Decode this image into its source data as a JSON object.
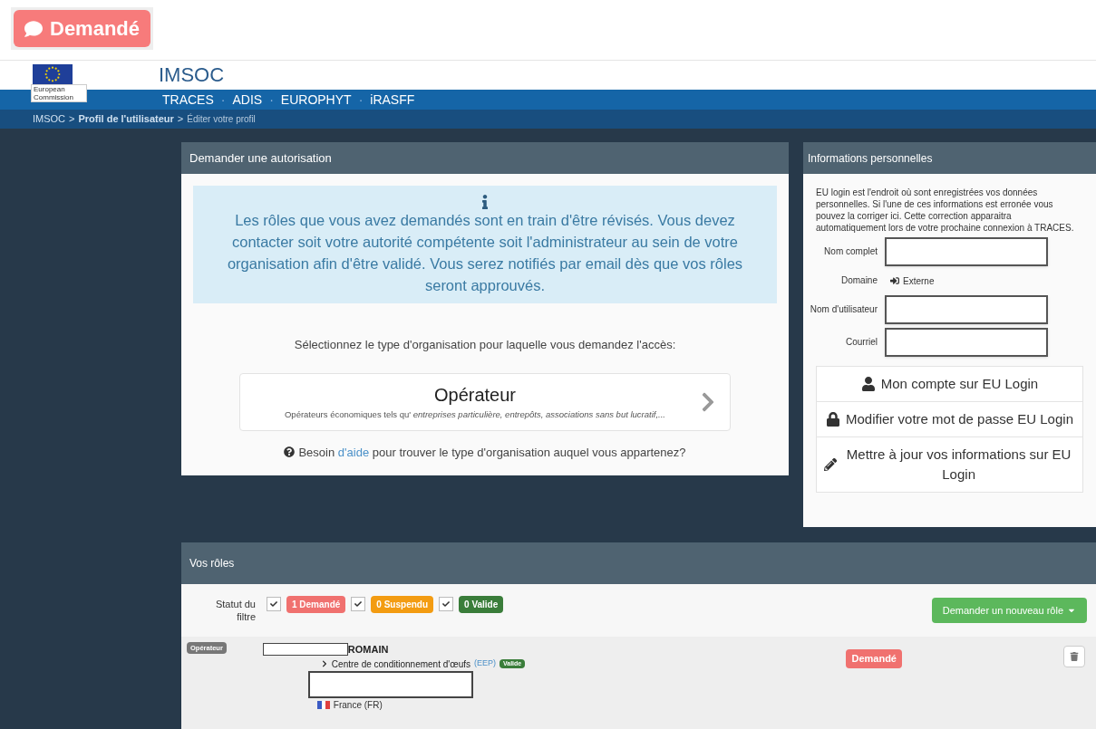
{
  "top_badge": {
    "label": "Demandé"
  },
  "header": {
    "logo_caption": "European Commission",
    "title": "IMSOC",
    "nav": [
      "TRACES",
      "ADIS",
      "EUROPHYT",
      "iRASFF"
    ],
    "nav_separator": "·",
    "breadcrumb_separator": ">",
    "breadcrumb": [
      "IMSOC",
      "Profil de l'utilisateur",
      "Éditer votre profil"
    ]
  },
  "request_panel": {
    "title": "Demander une autorisation",
    "info": "Les rôles que vous avez demandés sont en train d'être révisés. Vous devez contacter soit votre autorité compétente soit l'administrateur au sein de votre organisation afin d'être validé. Vous serez notifiés par email dès que vos rôles seront approuvés.",
    "prompt": "Sélectionnez le type d'organisation pour laquelle vous demandez l'accès:",
    "option": {
      "title": "Opérateur",
      "lead": "Opérateurs économiques tels qu'",
      "examples": "entreprises particulière, entrepôts, associations sans but lucratif,..."
    },
    "help": {
      "before": "Besoin",
      "link": "d'aide",
      "after": "pour trouver le type d'organisation auquel vous appartenez?"
    }
  },
  "personal_panel": {
    "title": "Informations personnelles",
    "intro": "EU login est l'endroit où sont enregistrées vos données personnelles. Si l'une de ces informations est erronée vous pouvez la corriger ici. Cette correction apparaitra automatiquement lors de votre prochaine connexion à TRACES.",
    "fields": [
      {
        "kind": "input",
        "label": "Nom complet"
      },
      {
        "kind": "text",
        "label": "Domaine",
        "value": "Externe"
      },
      {
        "kind": "input",
        "label": "Nom d'utilisateur"
      },
      {
        "kind": "input",
        "label": "Courriel"
      }
    ],
    "links": [
      {
        "kind": "user",
        "label": "Mon compte sur EU Login"
      },
      {
        "kind": "lock",
        "label": "Modifier votre mot de passe EU Login"
      },
      {
        "kind": "pencil",
        "label": "Mettre à jour vos informations sur EU Login"
      }
    ]
  },
  "roles_panel": {
    "title": "Vos rôles",
    "filter_label": "Statut du filtre",
    "filters": [
      {
        "label": "1 Demandé",
        "checked": true,
        "color": "#f0716f"
      },
      {
        "label": "0 Suspendu",
        "checked": true,
        "color": "#f39c12"
      },
      {
        "label": "0 Valide",
        "checked": true,
        "color": "#3a7d3a"
      }
    ],
    "new_role_button": "Demander un nouveau rôle",
    "rows": [
      {
        "type_tag": "Opérateur",
        "name": "ROMAIN",
        "activity": "Centre de conditionnement d'œufs",
        "activity_code": "(EEP)",
        "activity_status": "Valide",
        "country": "France (FR)",
        "status": "Demandé"
      }
    ]
  }
}
